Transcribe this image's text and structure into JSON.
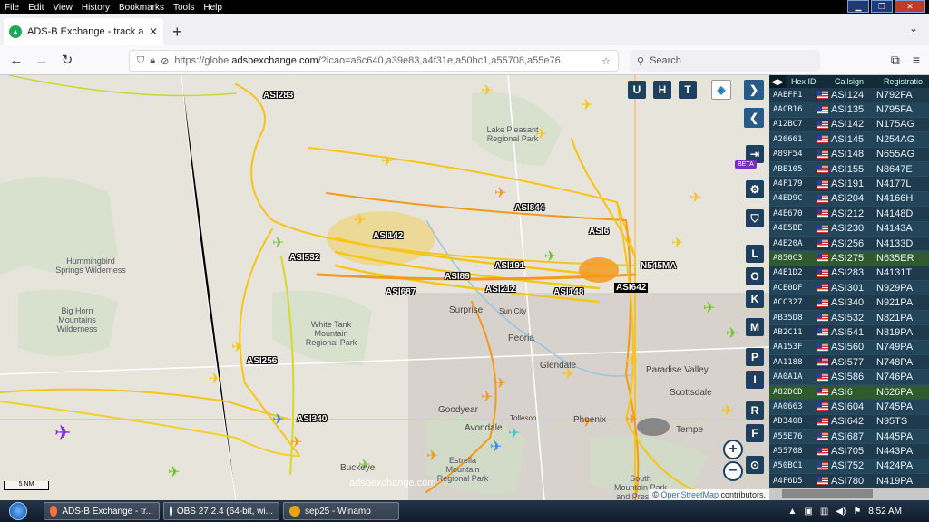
{
  "menubar": {
    "items": [
      "File",
      "Edit",
      "View",
      "History",
      "Bookmarks",
      "Tools",
      "Help"
    ]
  },
  "tab": {
    "title": "ADS-B Exchange - track aircraft",
    "close": "✕"
  },
  "nav": {
    "url_prefix": "https://globe.",
    "url_domain": "adsbexchange.com",
    "url_rest": "/?icao=a6c640,a39e83,a4f31e,a50bc1,a55708,a55e76",
    "search_placeholder": "Search"
  },
  "map": {
    "aircraft_labels": [
      "ASI283",
      "ASI844",
      "ASI142",
      "ASI6",
      "ASI532",
      "ASI191",
      "N545MA",
      "ASI89",
      "ASI687",
      "ASI212",
      "ASI148",
      "ASI642",
      "ASI256",
      "ASI340"
    ],
    "places": [
      "Hummingbird Springs Wilderness",
      "Big Horn Mountains Wilderness",
      "White Tank Mountain Regional Park",
      "Estrella Mountain Regional Park",
      "South Mountain Park and Preserve",
      "Lake Pleasant Regional Park",
      "Paradise Valley"
    ],
    "cities": [
      "Surprise",
      "Sun City",
      "Peoria",
      "Glendale",
      "Goodyear",
      "Avondale",
      "Tolleson",
      "Phoenix",
      "Scottsdale",
      "Tempe",
      "Buckeye"
    ],
    "controls": {
      "u": "U",
      "h": "H",
      "t": "T",
      "letters": [
        "L",
        "O",
        "K",
        "M",
        "P",
        "I",
        "R",
        "F"
      ],
      "beta": "BETA",
      "zoom_in": "+",
      "zoom_out": "−"
    },
    "scale": "5 NM",
    "watermark": "adsbexchange.com",
    "attribution_prefix": "© ",
    "attribution_link": "OpenStreetMap",
    "attribution_suffix": " contributors."
  },
  "table": {
    "headers": {
      "hex": "Hex ID",
      "callsign": "Callsign",
      "reg": "Registratio"
    },
    "rows": [
      {
        "hex": "AAEFF1",
        "call": "ASI124",
        "reg": "N792FA"
      },
      {
        "hex": "AACB16",
        "call": "ASI135",
        "reg": "N795FA"
      },
      {
        "hex": "A12BC7",
        "call": "ASI142",
        "reg": "N175AG"
      },
      {
        "hex": "A26661",
        "call": "ASI145",
        "reg": "N254AG"
      },
      {
        "hex": "A89F54",
        "call": "ASI148",
        "reg": "N655AG"
      },
      {
        "hex": "ABE105",
        "call": "ASI155",
        "reg": "N8647E"
      },
      {
        "hex": "A4F179",
        "call": "ASI191",
        "reg": "N4177L"
      },
      {
        "hex": "A4ED9C",
        "call": "ASI204",
        "reg": "N4166H"
      },
      {
        "hex": "A4E670",
        "call": "ASI212",
        "reg": "N4148D"
      },
      {
        "hex": "A4E5BE",
        "call": "ASI230",
        "reg": "N4143A"
      },
      {
        "hex": "A4E20A",
        "call": "ASI256",
        "reg": "N4133D"
      },
      {
        "hex": "A850C3",
        "call": "ASI275",
        "reg": "N635ER"
      },
      {
        "hex": "A4E1D2",
        "call": "ASI283",
        "reg": "N4131T"
      },
      {
        "hex": "ACE0DF",
        "call": "ASI301",
        "reg": "N929PA"
      },
      {
        "hex": "ACC327",
        "call": "ASI340",
        "reg": "N921PA"
      },
      {
        "hex": "AB35D8",
        "call": "ASI532",
        "reg": "N821PA"
      },
      {
        "hex": "AB2C11",
        "call": "ASI541",
        "reg": "N819PA"
      },
      {
        "hex": "AA153F",
        "call": "ASI560",
        "reg": "N749PA"
      },
      {
        "hex": "AA1188",
        "call": "ASI577",
        "reg": "N748PA"
      },
      {
        "hex": "AA0A1A",
        "call": "ASI586",
        "reg": "N746PA"
      },
      {
        "hex": "A82DCD",
        "call": "ASI6",
        "reg": "N626PA"
      },
      {
        "hex": "AA0663",
        "call": "ASI604",
        "reg": "N745PA"
      },
      {
        "hex": "AD3408",
        "call": "ASI642",
        "reg": "N95TS"
      },
      {
        "hex": "A55E76",
        "call": "ASI687",
        "reg": "N445PA"
      },
      {
        "hex": "A55708",
        "call": "ASI705",
        "reg": "N443PA"
      },
      {
        "hex": "A50BC1",
        "call": "ASI752",
        "reg": "N424PA"
      },
      {
        "hex": "A4F6D5",
        "call": "ASI780",
        "reg": "N419PA"
      }
    ]
  },
  "taskbar": {
    "tasks": [
      "ADS-B Exchange - tr...",
      "OBS 27.2.4 (64-bit, wi...",
      "sep25 - Winamp"
    ],
    "clock": "8:52 AM"
  },
  "colors": {
    "track_yellow": "#f5c518",
    "track_orange": "#f39a1c",
    "table_bg": "#1f3a4d",
    "map_bg": "#e7e4dc"
  }
}
